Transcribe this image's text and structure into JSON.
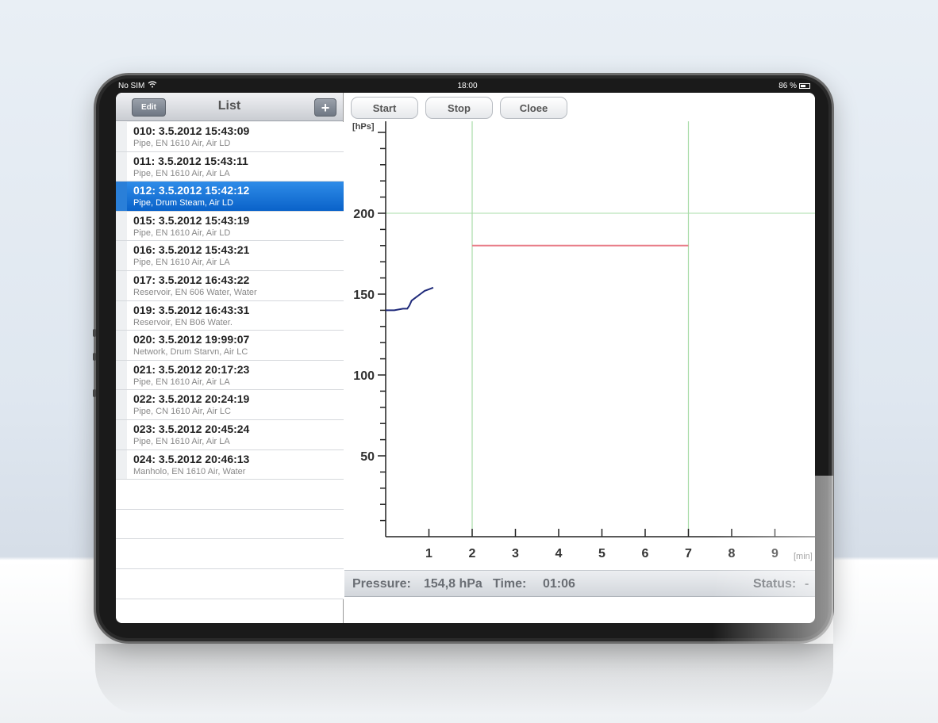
{
  "status_bar": {
    "carrier": "No SIM",
    "time": "18:00",
    "battery": "86 %"
  },
  "list_panel": {
    "title": "List",
    "edit_label": "Edit",
    "add_label": "+",
    "items": [
      {
        "title": "010: 3.5.2012 15:43:09",
        "subtitle": "Pipe, EN 1610 Air, Air LD",
        "selected": false
      },
      {
        "title": "011: 3.5.2012 15:43:11",
        "subtitle": "Pipe, EN 1610 Air, Air LA",
        "selected": false
      },
      {
        "title": "012: 3.5.2012 15:42:12",
        "subtitle": "Pipe, Drum Steam, Air LD",
        "selected": true
      },
      {
        "title": "015: 3.5.2012 15:43:19",
        "subtitle": "Pipe, EN 1610 Air, Air LD",
        "selected": false
      },
      {
        "title": "016: 3.5.2012 15:43:21",
        "subtitle": "Pipe, EN 1610 Air, Air LA",
        "selected": false
      },
      {
        "title": "017: 3.5.2012 16:43:22",
        "subtitle": "Reservoir, EN 606 Water, Water",
        "selected": false
      },
      {
        "title": "019: 3.5.2012 16:43:31",
        "subtitle": "Reservoir, EN B06 Water.",
        "selected": false
      },
      {
        "title": "020: 3.5.2012 19:99:07",
        "subtitle": "Network, Drum Starvn, Air LC",
        "selected": false
      },
      {
        "title": "021: 3.5.2012 20:17:23",
        "subtitle": "Pipe, EN 1610 Air, Air LA",
        "selected": false
      },
      {
        "title": "022: 3.5.2012 20:24:19",
        "subtitle": "Pipe, CN 1610 Air, Air LC",
        "selected": false
      },
      {
        "title": "023: 3.5.2012 20:45:24",
        "subtitle": "Pipe, EN 1610 Air, Air LA",
        "selected": false
      },
      {
        "title": "024: 3.5.2012 20:46:13",
        "subtitle": "Manholo, EN 1610 Air, Water",
        "selected": false
      }
    ]
  },
  "toolbar": {
    "start_label": "Start",
    "stop_label": "Stop",
    "close_label": "Cloee"
  },
  "info_bar": {
    "pressure_label": "Pressure:",
    "pressure_value": "154,8 hPa",
    "time_label": "Time:",
    "time_value": "01:06",
    "status_label": "Status:",
    "status_value": "-"
  },
  "chart_data": {
    "type": "line",
    "ylabel": "[hPs]",
    "xlabel": "[min]",
    "ylim": [
      0,
      260
    ],
    "xlim": [
      0,
      10
    ],
    "yticks": [
      50,
      100,
      150,
      200
    ],
    "xticks": [
      1,
      2,
      3,
      4,
      5,
      6,
      7,
      8,
      9
    ],
    "reference_lines": {
      "horizontal_y": 200,
      "vertical_x": [
        2,
        7
      ]
    },
    "target_segment": {
      "x": [
        2,
        7
      ],
      "y": 180
    },
    "series": [
      {
        "color": "#1f2a7a",
        "x": [
          0,
          0.2,
          0.4,
          0.5,
          0.55,
          0.6,
          0.7,
          0.8,
          0.9,
          1.0,
          1.1
        ],
        "y": [
          140,
          140,
          141,
          141,
          143,
          146,
          148,
          150,
          152,
          153,
          154
        ]
      }
    ],
    "colors": {
      "grid": "#a8dca8",
      "target": "#e87a86",
      "axis": "#222222"
    }
  }
}
